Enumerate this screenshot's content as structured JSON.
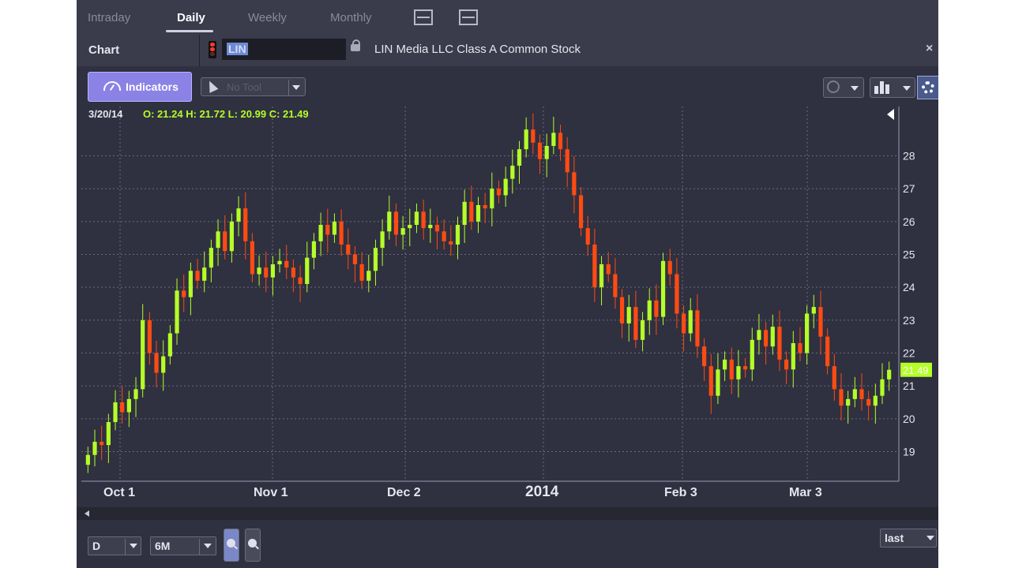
{
  "tabs": {
    "items": [
      "Intraday",
      "Daily",
      "Weekly",
      "Monthly"
    ],
    "active": "Daily"
  },
  "header": {
    "chart_label": "Chart",
    "symbol": "LIN",
    "company_name": "LIN Media LLC Class A Common Stock",
    "close_label": "×"
  },
  "toolbar": {
    "indicators_label": "Indicators",
    "tool_select_value": "No Tool"
  },
  "ohlc": {
    "date": "3/20/14",
    "values": "O: 21.24 H: 21.72 L: 20.99 C: 21.49"
  },
  "chart_data": {
    "type": "candlestick",
    "symbol": "LIN",
    "ylim": [
      18.1,
      29.5
    ],
    "yticks": [
      19,
      20,
      21,
      22,
      23,
      24,
      25,
      26,
      27,
      28
    ],
    "x_tick_labels": [
      "Oct 1",
      "Nov 1",
      "Dec 2",
      "2014",
      "Feb 3",
      "Mar 3"
    ],
    "last_price_label": "21.49",
    "last_price": 21.49,
    "up_color": "#b4ff27",
    "down_color": "#ff4b12",
    "grid": true,
    "close_series": [
      18.9,
      19.3,
      19.2,
      19.9,
      20.5,
      20.2,
      20.6,
      20.9,
      23.0,
      22.0,
      21.4,
      21.9,
      22.6,
      23.9,
      23.7,
      24.5,
      24.2,
      24.6,
      25.2,
      25.7,
      25.1,
      26.0,
      26.4,
      25.4,
      24.4,
      24.6,
      24.3,
      24.7,
      24.8,
      24.6,
      24.3,
      24.1,
      24.9,
      25.4,
      25.9,
      25.6,
      26.0,
      25.3,
      25.0,
      24.7,
      24.2,
      24.5,
      25.2,
      25.7,
      26.3,
      25.6,
      25.8,
      25.9,
      26.3,
      25.8,
      25.9,
      25.7,
      25.4,
      25.3,
      25.9,
      26.6,
      26.0,
      26.5,
      26.4,
      27.0,
      26.8,
      27.3,
      27.7,
      28.2,
      28.8,
      28.4,
      27.9,
      28.3,
      28.7,
      28.2,
      27.5,
      26.8,
      25.8,
      25.3,
      24.0,
      24.7,
      24.4,
      23.7,
      22.9,
      23.4,
      22.4,
      23.0,
      23.6,
      23.1,
      24.8,
      24.4,
      23.2,
      22.6,
      23.3,
      22.2,
      21.6,
      20.7,
      21.5,
      21.8,
      21.2,
      21.6,
      21.5,
      22.4,
      22.7,
      22.2,
      22.8,
      21.8,
      21.5,
      22.3,
      22.0,
      23.2,
      23.4,
      22.5,
      21.6,
      20.9,
      20.4,
      20.6,
      20.9,
      20.6,
      20.4,
      20.7,
      21.2,
      21.49
    ]
  },
  "bottom": {
    "interval_value": "D",
    "range_value": "6M",
    "price_type_value": "last"
  },
  "icons": {
    "link": "traffic-light-link-icon",
    "lock": "lock-icon",
    "close": "close-icon",
    "indicators": "gauge-icon",
    "tool": "cursor-arrow-icon",
    "crosshair": "globe-icon",
    "chart_style": "candlestick-icon",
    "settings": "gear-icon",
    "zoom_in": "magnifier-plus-icon",
    "zoom_out": "magnifier-icon"
  }
}
